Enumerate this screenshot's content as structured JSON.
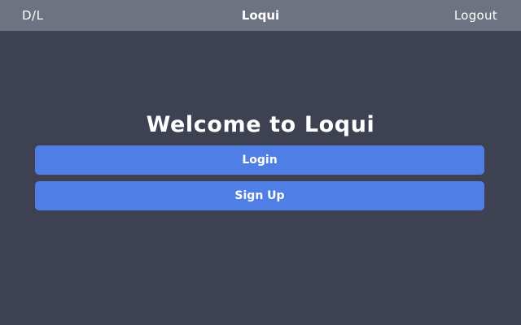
{
  "header": {
    "left_label": "D/L",
    "title": "Loqui",
    "logout_label": "Logout"
  },
  "main": {
    "welcome_text": "Welcome to Loqui",
    "login_label": "Login",
    "signup_label": "Sign Up"
  },
  "colors": {
    "topbar": "#6e7382",
    "background": "#3d4151",
    "button": "#4f7fe6",
    "text": "#ffffff"
  }
}
